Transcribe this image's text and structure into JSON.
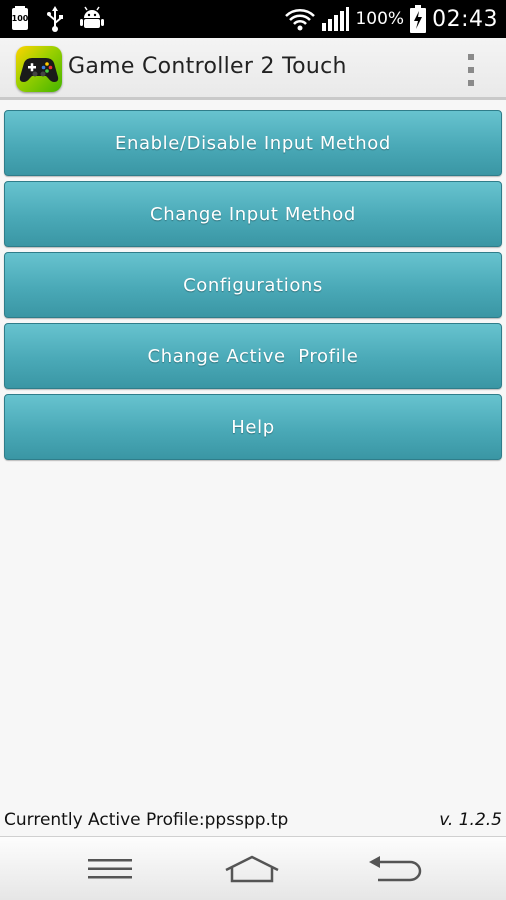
{
  "status_bar": {
    "notification_badge": "100",
    "battery_percent": "100%",
    "time": "02:43",
    "icons": [
      "storage-icon",
      "usb-icon",
      "android-debug-icon",
      "wifi-icon",
      "signal-icon",
      "battery-charging-icon"
    ]
  },
  "action_bar": {
    "title": "Game Controller 2 Touch",
    "icon": "gamepad-icon",
    "overflow_icon": "overflow-menu-icon"
  },
  "menu": {
    "items": [
      {
        "label": "Enable/Disable Input Method"
      },
      {
        "label": "Change Input Method"
      },
      {
        "label": "Configurations"
      },
      {
        "label": "Change Active  Profile"
      },
      {
        "label": "Help"
      }
    ]
  },
  "footer": {
    "profile_text": "Currently Active Profile:ppsspp.tp",
    "version": "v. 1.2.5"
  },
  "nav_bar": {
    "icons": [
      "menu-icon",
      "home-icon",
      "back-icon"
    ]
  },
  "colors": {
    "button_top": "#67c3cf",
    "button_bottom": "#3a96a4",
    "status_bar": "#000000"
  }
}
